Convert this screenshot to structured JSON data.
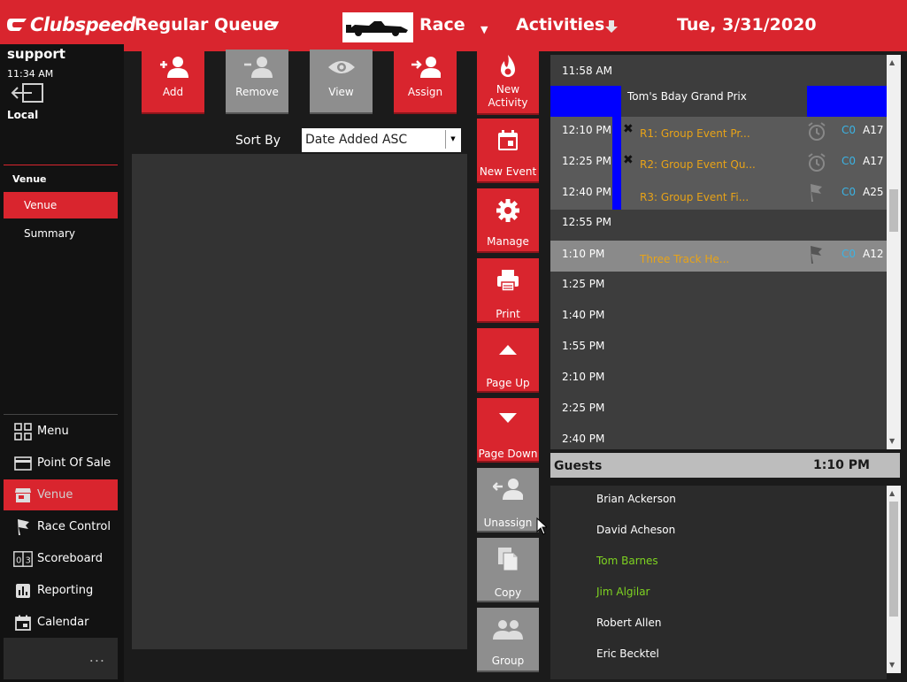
{
  "header": {
    "brand": "Clubspeed",
    "queue_title": "Regular Queue",
    "race_title": "Race",
    "activities_title": "Activities",
    "date": "Tue, 3/31/2020"
  },
  "user": {
    "name": "support",
    "time": "11:34 AM",
    "location": "Local"
  },
  "sidebar": {
    "section_title": "Venue",
    "sub_items": [
      {
        "label": "Venue",
        "active": true
      },
      {
        "label": "Summary",
        "active": false
      }
    ],
    "main_items": [
      {
        "label": "Menu",
        "icon": "grid-icon"
      },
      {
        "label": "Point Of Sale",
        "icon": "credit-card-icon"
      },
      {
        "label": "Venue",
        "icon": "store-icon",
        "active": true
      },
      {
        "label": "Race Control",
        "icon": "flag-icon"
      },
      {
        "label": "Scoreboard",
        "icon": "scoreboard-icon"
      },
      {
        "label": "Reporting",
        "icon": "bar-chart-icon"
      },
      {
        "label": "Calendar",
        "icon": "calendar-icon"
      }
    ],
    "more": "..."
  },
  "queue_actions": {
    "add": "Add",
    "remove": "Remove",
    "view": "View",
    "assign": "Assign"
  },
  "sort": {
    "label": "Sort By",
    "selected": "Date Added ASC"
  },
  "mid_actions": {
    "new_activity_1": "New",
    "new_activity_2": "Activity",
    "new_event": "New Event",
    "manage": "Manage",
    "print": "Print",
    "page_up": "Page Up",
    "page_down": "Page Down",
    "unassign": "Unassign",
    "copy": "Copy",
    "group": "Group"
  },
  "schedule": {
    "rows": [
      {
        "time": "11:58 AM"
      },
      {
        "time": "",
        "event": "Tom's Bday Grand Prix"
      },
      {
        "time": "12:10 PM",
        "name": "R1: Group Event Pr...",
        "code": "C0",
        "count": "A17"
      },
      {
        "time": "12:25 PM",
        "name": "R2: Group Event Qu...",
        "code": "C0",
        "count": "A17"
      },
      {
        "time": "12:40 PM",
        "name": "R3: Group Event Fi...",
        "code": "C0",
        "count": "A25"
      },
      {
        "time": "12:55 PM"
      },
      {
        "time": "1:10 PM",
        "name": "Three Track He...",
        "code": "C0",
        "count": "A12"
      },
      {
        "time": "1:25 PM"
      },
      {
        "time": "1:40 PM"
      },
      {
        "time": "1:55 PM"
      },
      {
        "time": "2:10 PM"
      },
      {
        "time": "2:25 PM"
      },
      {
        "time": "2:40 PM"
      }
    ]
  },
  "guests": {
    "title": "Guests",
    "time": "1:10 PM",
    "list": [
      {
        "name": "Brian Ackerson",
        "color": "#ffffff"
      },
      {
        "name": "David Acheson",
        "color": "#ffffff"
      },
      {
        "name": "Tom Barnes",
        "color": "#7ed321"
      },
      {
        "name": "Jim Algilar",
        "color": "#7ed321"
      },
      {
        "name": "Robert Allen",
        "color": "#ffffff"
      },
      {
        "name": "Eric Becktel",
        "color": "#ffffff"
      }
    ]
  },
  "colors": {
    "brand_red": "#d9252e",
    "event_blue": "#0000ff",
    "race_orange": "#e8a317",
    "code_cyan": "#3bb3e4",
    "checked_in_green": "#7ed321"
  }
}
